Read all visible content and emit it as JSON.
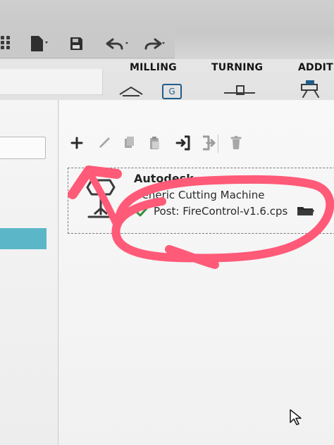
{
  "ribbon": {
    "tabs": [
      "MILLING",
      "TURNING",
      "ADDITIV"
    ]
  },
  "machine_card": {
    "vendor": "Autodesk",
    "machine_name": "Generic Cutting Machine",
    "post_label": "Post: FireControl-v1.6.cps"
  },
  "icons": {
    "quick_access": [
      "grid-icon",
      "document-icon",
      "save-icon",
      "undo-icon",
      "redo-icon"
    ],
    "library_toolbar": [
      "plus-icon",
      "pencil-icon",
      "copy-icon",
      "paste-icon",
      "import-icon",
      "export-icon",
      "trash-icon"
    ],
    "status": [
      "checkmark-icon",
      "folder-icon"
    ]
  },
  "colors": {
    "selection_teal": "#5bb7c8",
    "annotation_pink": "#ff5a78",
    "check_green": "#2f8f3a"
  }
}
